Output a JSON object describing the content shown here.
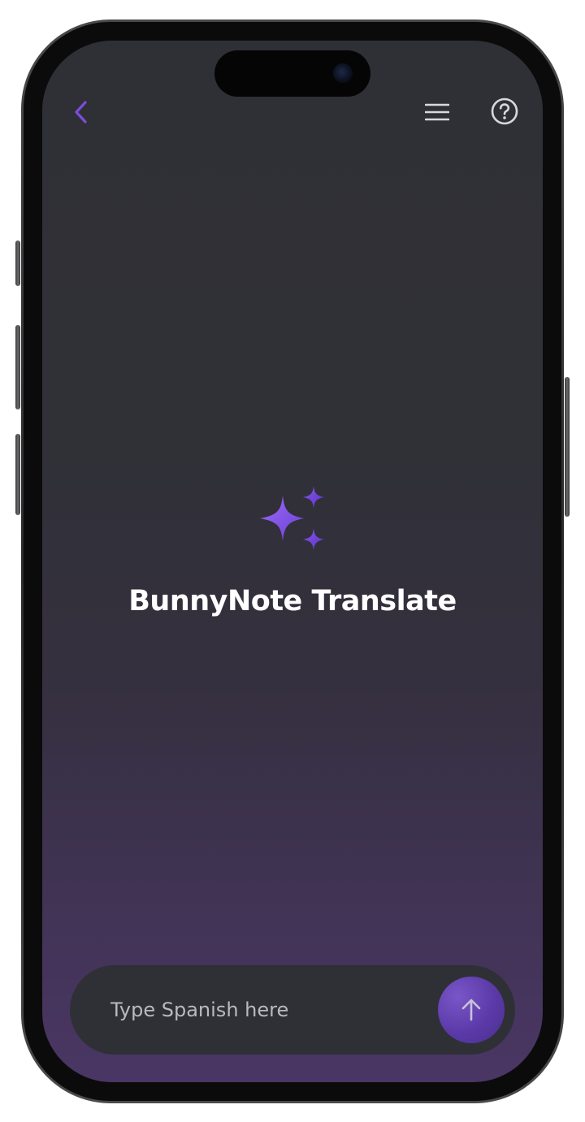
{
  "header": {
    "back_icon": "chevron-left-icon",
    "menu_icon": "hamburger-menu-icon",
    "help_icon": "question-circle-icon"
  },
  "hero": {
    "icon": "sparkles-icon",
    "title": "BunnyNote Translate"
  },
  "composer": {
    "placeholder": "Type Spanish here",
    "value": "",
    "send_icon": "arrow-up-icon"
  },
  "colors": {
    "accent": "#7b4ddb",
    "accent_light": "#8e5cf0",
    "background_top": "#2f3036",
    "background_bottom": "#4a3664",
    "icon_gray": "#d8d8dc",
    "title_text": "#ffffff"
  }
}
